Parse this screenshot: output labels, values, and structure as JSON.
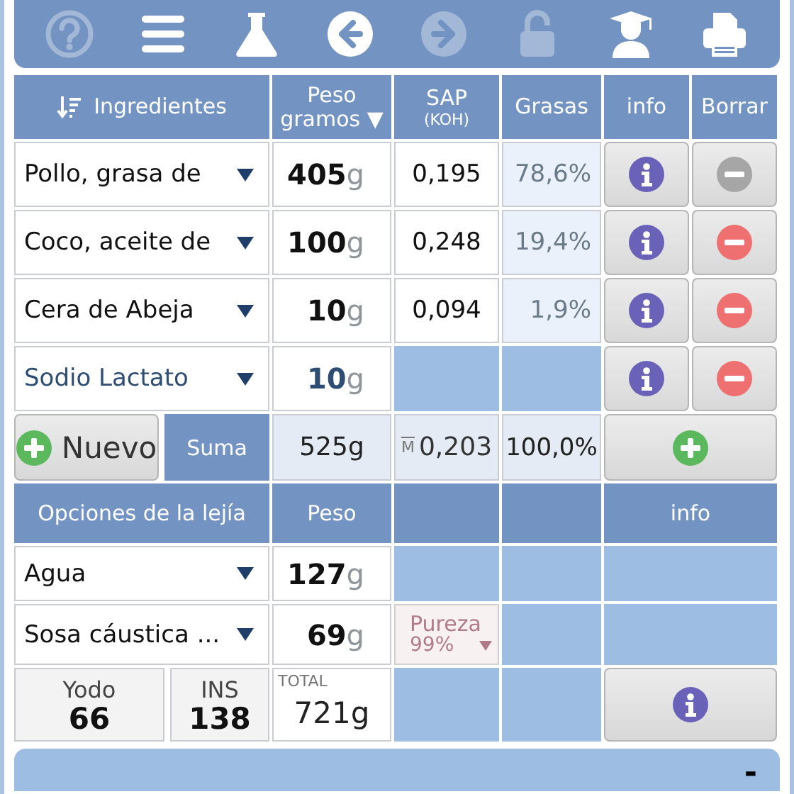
{
  "toolbar": [
    {
      "disabled": true
    },
    {
      "disabled": false
    },
    {
      "disabled": false
    },
    {
      "disabled": false
    },
    {
      "disabled": true
    },
    {
      "disabled": true
    },
    {
      "disabled": false
    },
    {
      "disabled": false
    }
  ],
  "columns": [
    {
      "label": "Ingredientes"
    },
    {
      "label": "Peso gramos ▼"
    },
    {
      "label": "SAP",
      "sub": "(KOH)"
    },
    {
      "label": "Grasas"
    },
    {
      "label": "info"
    },
    {
      "label": "Borrar"
    }
  ],
  "ingredients": [
    {
      "kind": "oil",
      "name": "Pollo, grasa de",
      "weight": "**405**g",
      "sap": "0,195",
      "fat": "78,6%",
      "removable": false
    },
    {
      "kind": "oil",
      "name": "Coco, aceite de",
      "weight": "**100**g",
      "sap": "0,248",
      "fat": "19,4%",
      "removable": true
    },
    {
      "kind": "oil",
      "name": "Cera de Abeja",
      "weight": "**10**g",
      "sap": "0,094",
      "fat": "1,9%",
      "removable": true
    },
    {
      "kind": "additive",
      "name": "Sodio Lactato",
      "weight": "**10**g",
      "removable": true
    }
  ],
  "sum_row": {
    "new_button": "Nuevo",
    "label": "Suma",
    "weight": "525g",
    "sap_prefix": "M",
    "sap": "0,203",
    "fat": "100,0%"
  },
  "lye_header": {
    "options": "Opciones de la lejía",
    "weight": "Peso",
    "info": "info"
  },
  "lye": [
    {
      "kind": "water",
      "name": "Agua",
      "weight": "**127**g"
    },
    {
      "kind": "lye",
      "name": "Sosa cáustica ...",
      "weight": "**69**g",
      "purity_label": "Pureza",
      "purity": "99%"
    }
  ],
  "stats": {
    "iodine_label": "Yodo",
    "iodine": "66",
    "ins_label": "INS",
    "ins": "138",
    "total_label": "TOTAL",
    "total": "721g"
  },
  "bottom_bar": {
    "text": "-"
  }
}
